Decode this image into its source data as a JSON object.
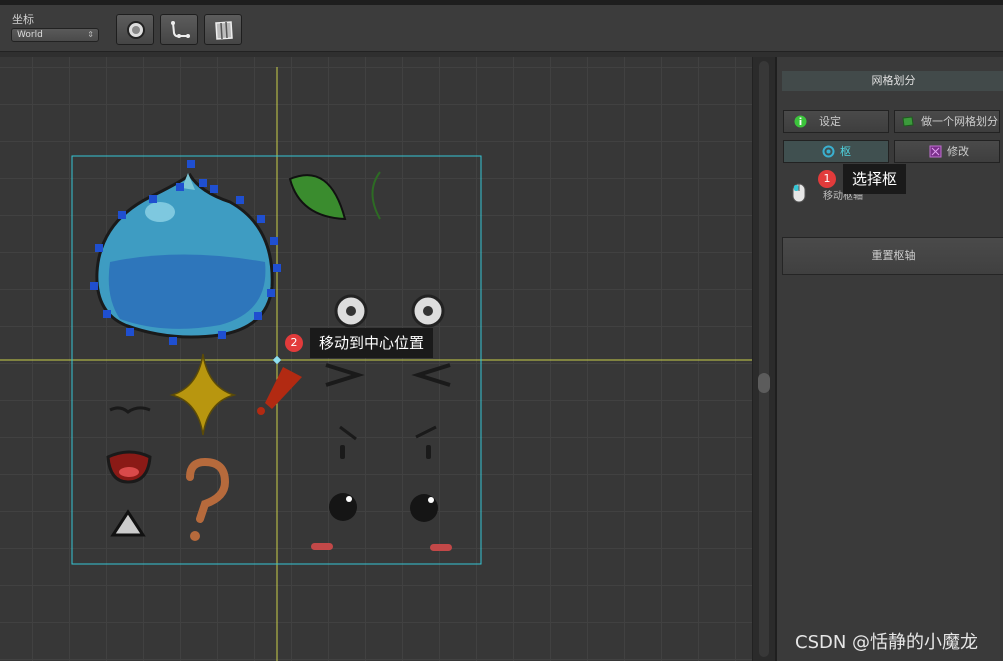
{
  "toolbar": {
    "coord_label": "坐标",
    "coord_value": "World",
    "tools": [
      "circle-tool",
      "path-tool",
      "mesh-tool"
    ]
  },
  "panel": {
    "title": "网格划分",
    "buttons": {
      "setup": "设定",
      "make_mesh": "做一个网格划分",
      "pivot": "枢",
      "modify": "修改"
    },
    "move_pivot_label": "移动枢轴",
    "reset_pivot": "重置枢轴"
  },
  "annotations": {
    "callout1": {
      "num": "1",
      "text": "选择枢"
    },
    "callout2": {
      "num": "2",
      "text": "移动到中心位置"
    }
  },
  "watermark": "CSDN @恬静的小魔龙",
  "colors": {
    "accent_cyan": "#35c6d4",
    "guide_yellow": "#c9cf4a",
    "control_point_blue": "#1f4fd0",
    "badge_red": "#e23b3b"
  }
}
